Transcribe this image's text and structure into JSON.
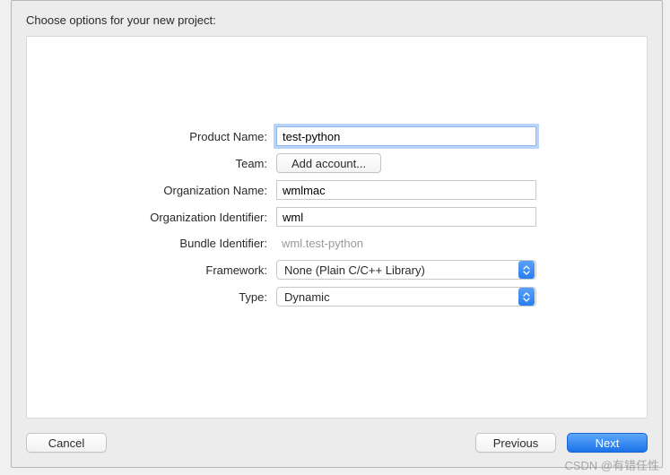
{
  "header": {
    "title": "Choose options for your new project:"
  },
  "form": {
    "product_name": {
      "label": "Product Name:",
      "value": "test-python"
    },
    "team": {
      "label": "Team:",
      "button": "Add account..."
    },
    "org_name": {
      "label": "Organization Name:",
      "value": "wmlmac"
    },
    "org_identifier": {
      "label": "Organization Identifier:",
      "value": "wml"
    },
    "bundle_identifier": {
      "label": "Bundle Identifier:",
      "value": "wml.test-python"
    },
    "framework": {
      "label": "Framework:",
      "value": "None (Plain C/C++ Library)"
    },
    "type": {
      "label": "Type:",
      "value": "Dynamic"
    }
  },
  "footer": {
    "cancel": "Cancel",
    "previous": "Previous",
    "next": "Next"
  },
  "watermark": "CSDN @有错任性"
}
